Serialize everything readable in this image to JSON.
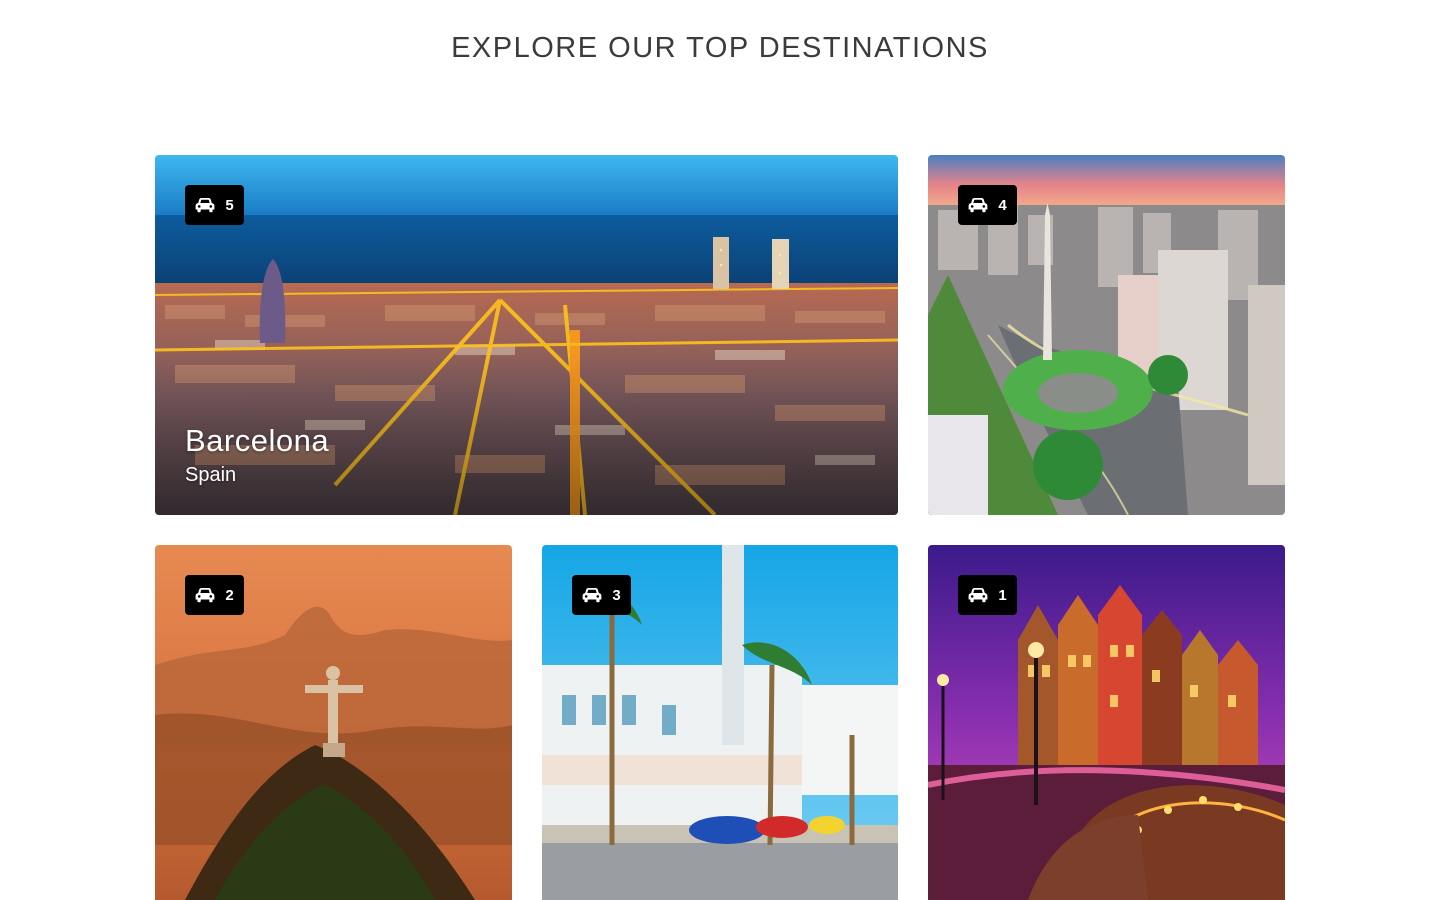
{
  "section": {
    "title": "EXPLORE OUR TOP DESTINATIONS"
  },
  "badge_icon": "car-icon",
  "colors": {
    "badge_bg": "#000000",
    "title_text": "#3b3b3b"
  },
  "destinations": [
    {
      "count": "5",
      "city": "Barcelona",
      "country": "Spain"
    },
    {
      "count": "4"
    },
    {
      "count": "2"
    },
    {
      "count": "3"
    },
    {
      "count": "1"
    }
  ]
}
